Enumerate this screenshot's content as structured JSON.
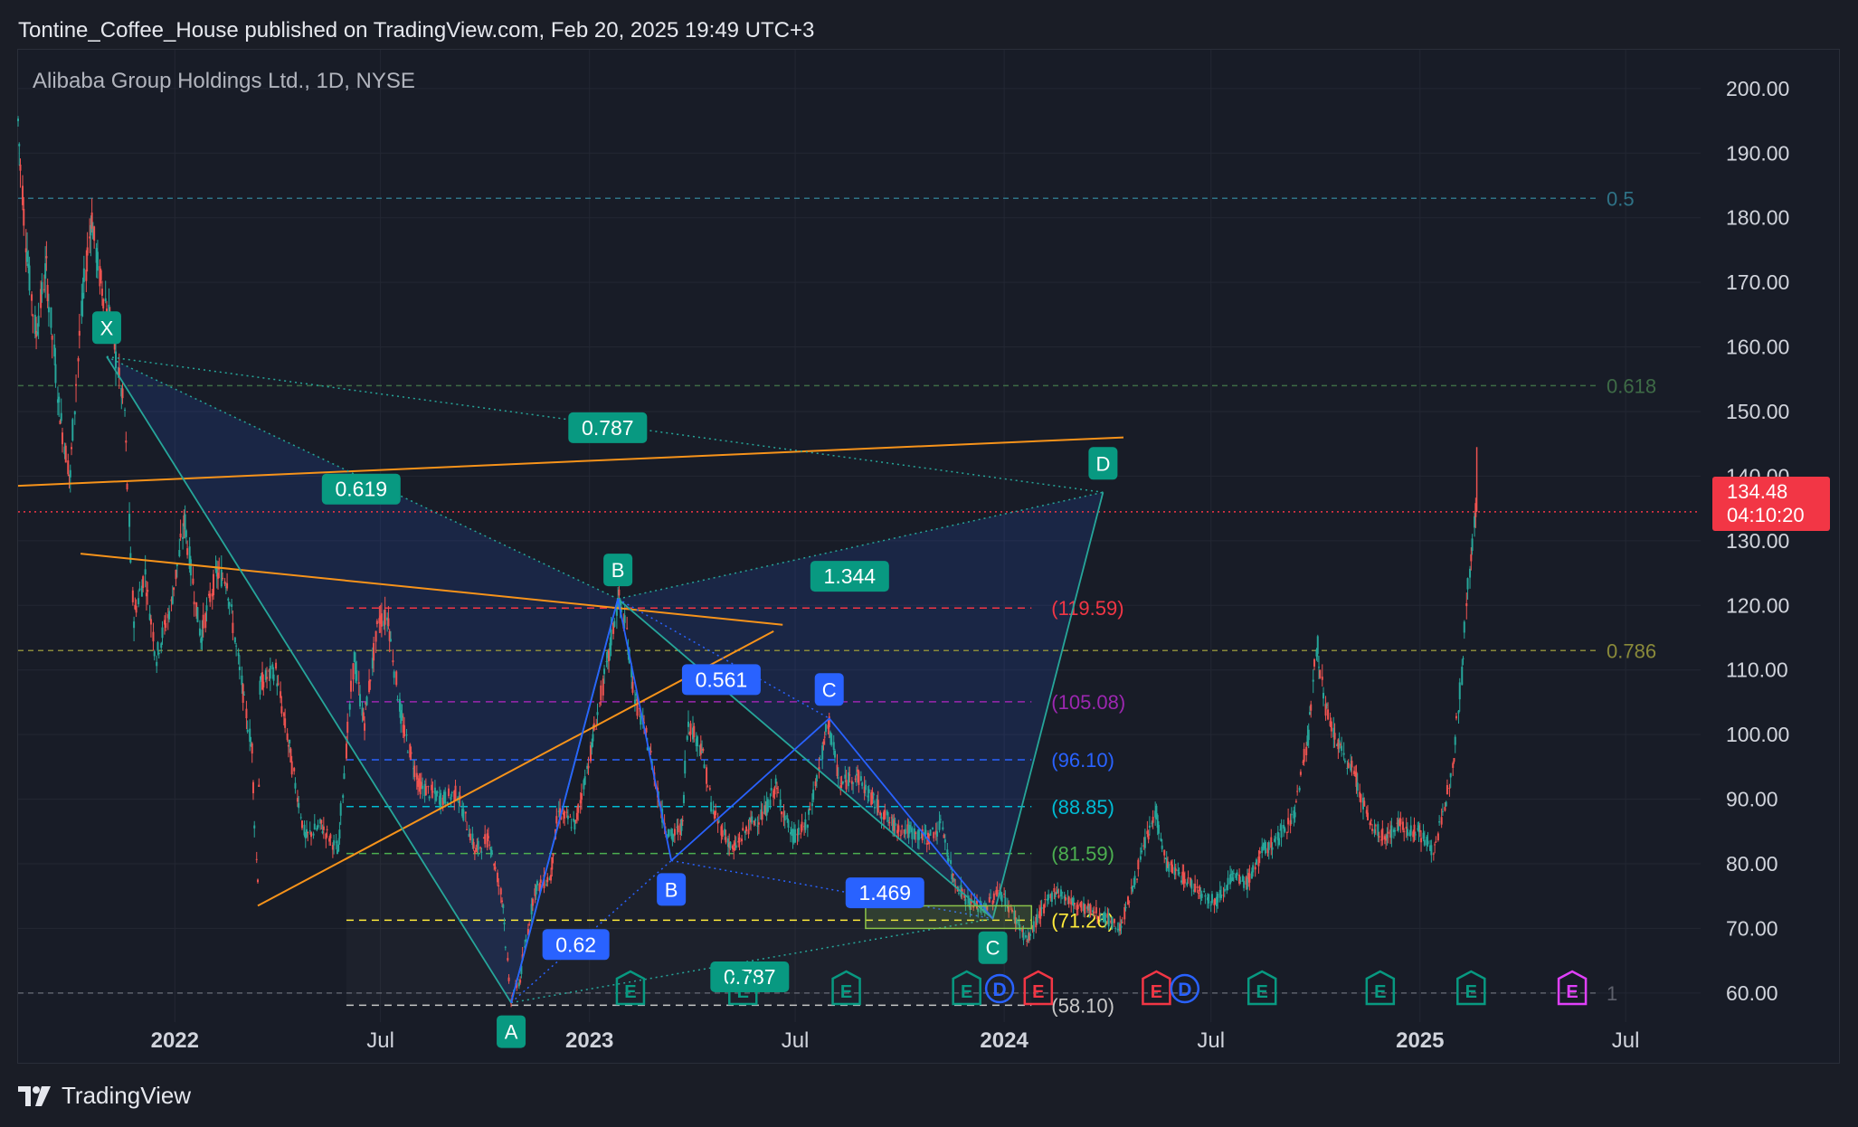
{
  "header": {
    "published_by": "Tontine_Coffee_House published on TradingView.com, Feb 20, 2025 19:49 UTC+3"
  },
  "symbol": {
    "title": "Alibaba Group Holdings Ltd., 1D, NYSE"
  },
  "footer": {
    "brand": "TradingView",
    "logo_icon": "tradingview-logo-icon"
  },
  "price_badge": {
    "price": "134.48",
    "countdown": "04:10:20",
    "color": "#f23645"
  },
  "chart_data": {
    "type": "candlestick",
    "ylim": [
      55.5,
      206
    ],
    "xlim": [
      "2021-08-16",
      "2025-09-05"
    ],
    "yticks": [
      60,
      70,
      80,
      90,
      100,
      110,
      120,
      130,
      140,
      150,
      160,
      170,
      180,
      190,
      200
    ],
    "ytick_labels": [
      "60.00",
      "70.00",
      "80.00",
      "90.00",
      "100.00",
      "110.00",
      "120.00",
      "130.00",
      "140.00",
      "150.00",
      "160.00",
      "170.00",
      "180.00",
      "190.00",
      "200.00"
    ],
    "xticks": [
      {
        "date": "2022-01-01",
        "label": "2022",
        "bold": true
      },
      {
        "date": "2022-07-01",
        "label": "Jul",
        "bold": false
      },
      {
        "date": "2023-01-01",
        "label": "2023",
        "bold": true
      },
      {
        "date": "2023-07-01",
        "label": "Jul",
        "bold": false
      },
      {
        "date": "2024-01-01",
        "label": "2024",
        "bold": true
      },
      {
        "date": "2024-07-01",
        "label": "Jul",
        "bold": false
      },
      {
        "date": "2025-01-01",
        "label": "2025",
        "bold": true
      },
      {
        "date": "2025-07-01",
        "label": "Jul",
        "bold": false
      }
    ],
    "grid": true,
    "up_color": "#26a69a",
    "down_color": "#ef5350",
    "last_price": 134.48,
    "price_path": [
      [
        "2021-08-16",
        195
      ],
      [
        "2021-08-24",
        175
      ],
      [
        "2021-09-01",
        162
      ],
      [
        "2021-09-10",
        172
      ],
      [
        "2021-09-22",
        150
      ],
      [
        "2021-10-01",
        140
      ],
      [
        "2021-10-11",
        165
      ],
      [
        "2021-10-20",
        180
      ],
      [
        "2021-10-28",
        170
      ],
      [
        "2021-11-05",
        165
      ],
      [
        "2021-11-18",
        150
      ],
      [
        "2021-11-26",
        118
      ],
      [
        "2021-12-06",
        125
      ],
      [
        "2021-12-16",
        112
      ],
      [
        "2021-12-29",
        120
      ],
      [
        "2022-01-10",
        133
      ],
      [
        "2022-01-24",
        115
      ],
      [
        "2022-02-07",
        125
      ],
      [
        "2022-02-16",
        124
      ],
      [
        "2022-03-01",
        108
      ],
      [
        "2022-03-10",
        98
      ],
      [
        "2022-03-15",
        78
      ],
      [
        "2022-03-18",
        108
      ],
      [
        "2022-03-31",
        110
      ],
      [
        "2022-04-12",
        98
      ],
      [
        "2022-04-26",
        84
      ],
      [
        "2022-05-10",
        86
      ],
      [
        "2022-05-25",
        82
      ],
      [
        "2022-06-08",
        112
      ],
      [
        "2022-06-17",
        102
      ],
      [
        "2022-06-30",
        118
      ],
      [
        "2022-07-08",
        118
      ],
      [
        "2022-07-20",
        102
      ],
      [
        "2022-08-05",
        92
      ],
      [
        "2022-08-25",
        90
      ],
      [
        "2022-09-07",
        91
      ],
      [
        "2022-09-23",
        82
      ],
      [
        "2022-10-05",
        84
      ],
      [
        "2022-10-17",
        74
      ],
      [
        "2022-10-24",
        59
      ],
      [
        "2022-11-01",
        62
      ],
      [
        "2022-11-14",
        76
      ],
      [
        "2022-11-28",
        78
      ],
      [
        "2022-12-05",
        88
      ],
      [
        "2022-12-20",
        86
      ],
      [
        "2023-01-03",
        98
      ],
      [
        "2023-01-18",
        112
      ],
      [
        "2023-01-27",
        121
      ],
      [
        "2023-02-03",
        116
      ],
      [
        "2023-02-10",
        106
      ],
      [
        "2023-02-23",
        98
      ],
      [
        "2023-03-07",
        87
      ],
      [
        "2023-03-15",
        84
      ],
      [
        "2023-03-24",
        86
      ],
      [
        "2023-03-29",
        102
      ],
      [
        "2023-04-10",
        98
      ],
      [
        "2023-04-20",
        88
      ],
      [
        "2023-05-08",
        82
      ],
      [
        "2023-05-22",
        86
      ],
      [
        "2023-06-05",
        88
      ],
      [
        "2023-06-14",
        92
      ],
      [
        "2023-06-29",
        84
      ],
      [
        "2023-07-12",
        86
      ],
      [
        "2023-07-26",
        98
      ],
      [
        "2023-07-31",
        102
      ],
      [
        "2023-08-10",
        92
      ],
      [
        "2023-08-24",
        94
      ],
      [
        "2023-09-07",
        90
      ],
      [
        "2023-09-25",
        86
      ],
      [
        "2023-10-10",
        85
      ],
      [
        "2023-10-26",
        84
      ],
      [
        "2023-11-08",
        86
      ],
      [
        "2023-11-17",
        78
      ],
      [
        "2023-12-01",
        74
      ],
      [
        "2023-12-15",
        73
      ],
      [
        "2023-12-28",
        76
      ],
      [
        "2024-01-10",
        72
      ],
      [
        "2024-01-22",
        68
      ],
      [
        "2024-02-01",
        72
      ],
      [
        "2024-02-16",
        76
      ],
      [
        "2024-03-01",
        74
      ],
      [
        "2024-03-15",
        73
      ],
      [
        "2024-03-28",
        72
      ],
      [
        "2024-04-12",
        70
      ],
      [
        "2024-04-23",
        76
      ],
      [
        "2024-05-06",
        84
      ],
      [
        "2024-05-14",
        88
      ],
      [
        "2024-05-23",
        80
      ],
      [
        "2024-06-06",
        78
      ],
      [
        "2024-06-21",
        76
      ],
      [
        "2024-07-05",
        74
      ],
      [
        "2024-07-19",
        78
      ],
      [
        "2024-08-02",
        77
      ],
      [
        "2024-08-16",
        82
      ],
      [
        "2024-08-30",
        84
      ],
      [
        "2024-09-13",
        88
      ],
      [
        "2024-09-25",
        100
      ],
      [
        "2024-10-03",
        114
      ],
      [
        "2024-10-10",
        104
      ],
      [
        "2024-10-22",
        98
      ],
      [
        "2024-11-05",
        94
      ],
      [
        "2024-11-18",
        86
      ],
      [
        "2024-12-02",
        84
      ],
      [
        "2024-12-13",
        86
      ],
      [
        "2024-12-31",
        85
      ],
      [
        "2025-01-13",
        82
      ],
      [
        "2025-01-23",
        88
      ],
      [
        "2025-01-31",
        97
      ],
      [
        "2025-02-07",
        109
      ],
      [
        "2025-02-14",
        126
      ],
      [
        "2025-02-20",
        134.48
      ]
    ],
    "annotations": {
      "points": [
        {
          "label": "X",
          "date": "2021-11-02",
          "value": 158.5,
          "color": "#089981"
        },
        {
          "label": "A",
          "date": "2022-10-24",
          "value": 58.5,
          "color": "#089981",
          "placement": "below"
        },
        {
          "label": "B",
          "date": "2023-01-26",
          "value": 121,
          "color": "#089981"
        },
        {
          "label": "D",
          "date": "2024-03-28",
          "value": 137.5,
          "color": "#089981"
        },
        {
          "label": "B",
          "date": "2023-03-14",
          "value": 80.5,
          "color": "#2962ff",
          "placement": "below"
        },
        {
          "label": "C",
          "date": "2023-07-31",
          "value": 102.5,
          "color": "#2962ff"
        },
        {
          "label": "C",
          "date": "2023-12-22",
          "value": 71.5,
          "color": "#089981",
          "placement": "below"
        }
      ],
      "ratios": [
        {
          "text": "0.619",
          "date": "2022-06-14",
          "value": 138,
          "color": "#089981"
        },
        {
          "text": "0.787",
          "date": "2023-01-17",
          "value": 147.5,
          "color": "#089981"
        },
        {
          "text": "1.344",
          "date": "2023-08-18",
          "value": 124.5,
          "color": "#089981"
        },
        {
          "text": "0.561",
          "date": "2023-04-27",
          "value": 108.5,
          "color": "#2962ff"
        },
        {
          "text": "1.469",
          "date": "2023-09-18",
          "value": 75.5,
          "color": "#2962ff"
        },
        {
          "text": "0.62",
          "date": "2022-12-20",
          "value": 67.5,
          "color": "#2962ff"
        },
        {
          "text": "0.787",
          "date": "2023-05-22",
          "value": 62.5,
          "color": "#089981"
        }
      ],
      "fib_levels": [
        {
          "value": 183,
          "label": "0.5",
          "color": "#2f7387"
        },
        {
          "value": 154,
          "label": "0.618",
          "color": "#3e6b46"
        },
        {
          "value": 113,
          "label": "0.786",
          "color": "#8a8a3a"
        },
        {
          "value": 60,
          "label": "1",
          "color": "#5d606b"
        }
      ],
      "projection_levels": [
        {
          "value": 119.59,
          "label": "(119.59)",
          "color": "#f23645"
        },
        {
          "value": 105.08,
          "label": "(105.08)",
          "color": "#9c27b0"
        },
        {
          "value": 96.1,
          "label": "(96.10)",
          "color": "#2962ff"
        },
        {
          "value": 88.85,
          "label": "(88.85)",
          "color": "#00bcd4"
        },
        {
          "value": 81.59,
          "label": "(81.59)",
          "color": "#4caf50"
        },
        {
          "value": 71.26,
          "label": "(71.26)",
          "color": "#ffeb3b"
        },
        {
          "value": 58.1,
          "label": "(58.10)",
          "color": "#c8c8c8"
        }
      ],
      "orange_lines": [
        {
          "from": [
            "2021-08-16",
            138.5
          ],
          "to": [
            "2024-04-15",
            146
          ]
        },
        {
          "from": [
            "2021-10-10",
            128
          ],
          "to": [
            "2023-06-20",
            117
          ]
        },
        {
          "from": [
            "2022-03-15",
            73.5
          ],
          "to": [
            "2023-06-12",
            116
          ]
        }
      ],
      "events": [
        {
          "date": "2022-10-24",
          "text": "A",
          "kind": "point"
        },
        {
          "date": "2023-02-06",
          "text": "E",
          "kind": "earnings",
          "color": "#089981"
        },
        {
          "date": "2023-05-16",
          "text": "E",
          "kind": "earnings",
          "color": "#089981"
        },
        {
          "date": "2023-08-15",
          "text": "E",
          "kind": "earnings",
          "color": "#089981"
        },
        {
          "date": "2023-11-29",
          "text": "E",
          "kind": "earnings",
          "color": "#089981"
        },
        {
          "date": "2023-12-28",
          "text": "D",
          "kind": "dividend",
          "color": "#2962ff"
        },
        {
          "date": "2024-01-31",
          "text": "E",
          "kind": "earnings",
          "color": "#f23645"
        },
        {
          "date": "2024-05-14",
          "text": "E",
          "kind": "earnings",
          "color": "#f23645"
        },
        {
          "date": "2024-06-08",
          "text": "D",
          "kind": "dividend",
          "color": "#2962ff"
        },
        {
          "date": "2024-08-15",
          "text": "E",
          "kind": "earnings",
          "color": "#089981"
        },
        {
          "date": "2024-11-27",
          "text": "E",
          "kind": "earnings",
          "color": "#089981"
        },
        {
          "date": "2025-02-15",
          "text": "E",
          "kind": "earnings",
          "color": "#089981"
        },
        {
          "date": "2025-05-15",
          "text": "E",
          "kind": "earnings",
          "color": "#e040fb"
        }
      ]
    }
  }
}
